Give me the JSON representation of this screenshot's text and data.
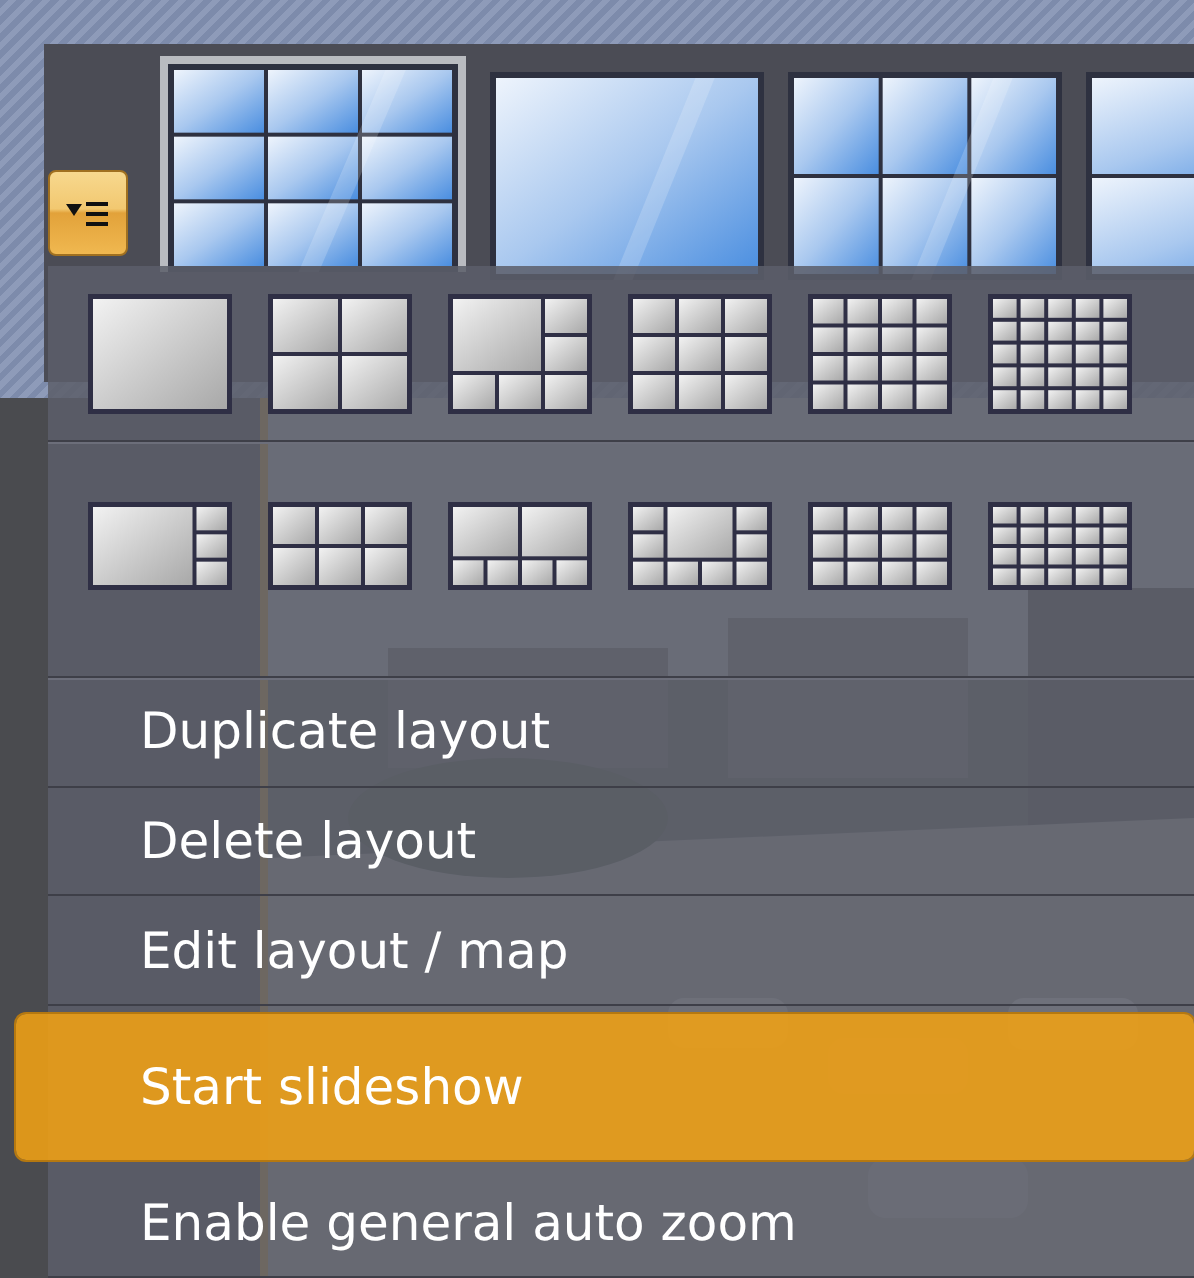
{
  "layout_thumbnails": [
    {
      "kind": "grid-3x3",
      "selected": true
    },
    {
      "kind": "single",
      "selected": false
    },
    {
      "kind": "grid-3x2",
      "selected": false
    },
    {
      "kind": "grid-2-rows",
      "selected": false
    }
  ],
  "menu": {
    "items": [
      {
        "label": "Duplicate layout",
        "selected": false
      },
      {
        "label": "Delete layout",
        "selected": false
      },
      {
        "label": "Edit layout / map",
        "selected": false
      },
      {
        "label": "Start slideshow",
        "selected": true
      },
      {
        "label": "Enable general auto zoom",
        "selected": false
      }
    ]
  }
}
